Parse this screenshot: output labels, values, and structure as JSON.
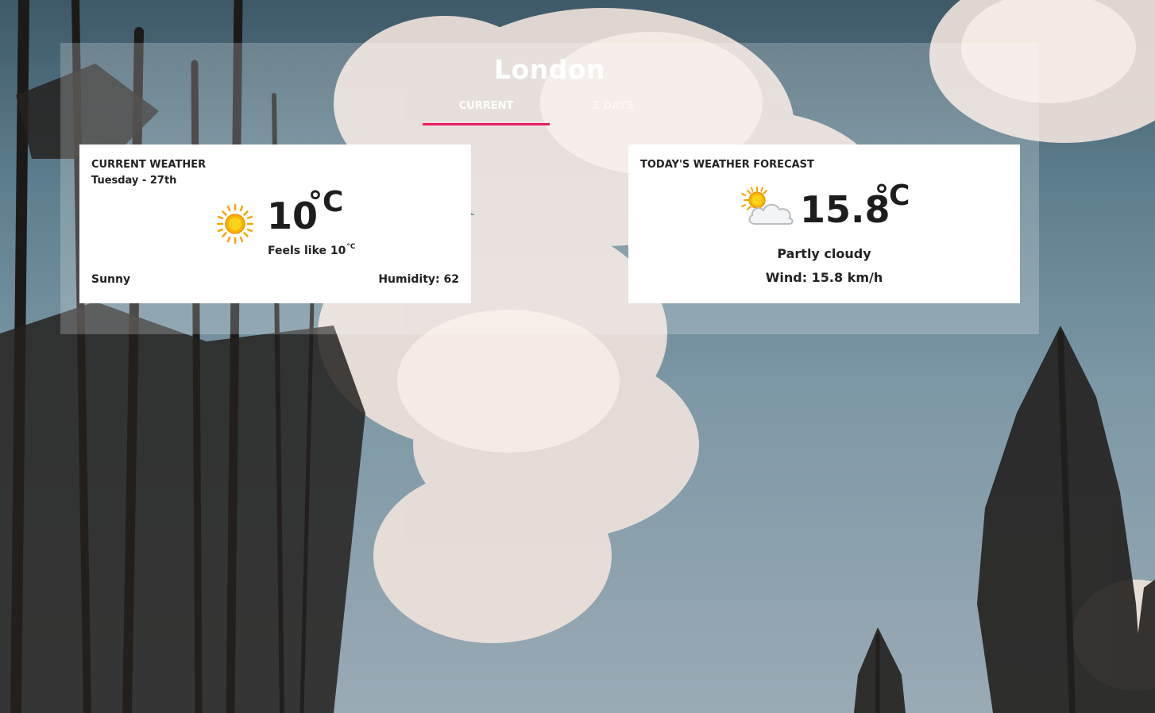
{
  "header": {
    "city": "London"
  },
  "tabs": [
    {
      "label": "CURRENT",
      "active": true
    },
    {
      "label": "3 DAYS",
      "active": false
    }
  ],
  "current": {
    "title": "CURRENT WEATHER",
    "date": "Tuesday - 27th",
    "temp": "10",
    "unit": "°C",
    "feels_like_label": "Feels like 10",
    "feels_like_unit": "°C",
    "condition": "Sunny",
    "humidity": "Humidity: 62",
    "icon": "sun-icon"
  },
  "forecast": {
    "title": "TODAY'S WEATHER FORECAST",
    "temp": "15.8",
    "unit": "°C",
    "condition": "Partly cloudy",
    "wind": "Wind: 15.8 km/h",
    "icon": "partly-cloudy-icon"
  },
  "colors": {
    "accent": "#e91e63",
    "card_bg": "#ffffff",
    "text": "#1d1d1d"
  }
}
